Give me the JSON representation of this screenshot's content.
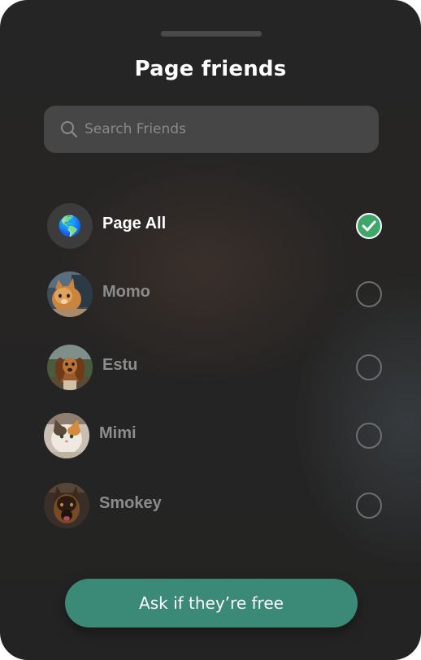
{
  "sheet": {
    "title": "Page friends"
  },
  "search": {
    "placeholder": "Search Friends",
    "icon": "search-icon"
  },
  "friends": [
    {
      "name": "Page All",
      "avatar": "globe-emoji",
      "glyph": "🌎",
      "selected": true
    },
    {
      "name": "Momo",
      "avatar": "orange-tabby-cat-photo",
      "selected": false
    },
    {
      "name": "Estu",
      "avatar": "brown-long-eared-dog-photo",
      "selected": false
    },
    {
      "name": "Mimi",
      "avatar": "calico-cat-photo",
      "selected": false
    },
    {
      "name": "Smokey",
      "avatar": "german-shepherd-photo",
      "selected": false
    }
  ],
  "cta": {
    "label": "Ask if they’re free"
  },
  "colors": {
    "accent": "#3b8a77",
    "check": "#3ea86a",
    "background": "#252525",
    "search_bg": "#464646"
  }
}
